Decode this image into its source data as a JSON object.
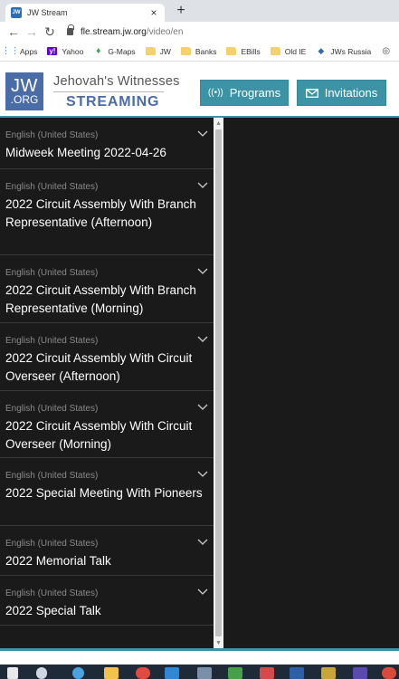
{
  "browser": {
    "tab_title": "JW Stream",
    "favicon_text": "JW",
    "tab_close": "×",
    "new_tab": "+",
    "url_host": "fle.stream.jw.org",
    "url_path": "/video/en",
    "bookmarks": [
      {
        "label": "Apps",
        "icon": "apps-grid-icon"
      },
      {
        "label": "Yahoo",
        "icon": "yahoo-icon"
      },
      {
        "label": "G-Maps",
        "icon": "map-pin-icon"
      },
      {
        "label": "JW",
        "icon": "folder-icon"
      },
      {
        "label": "Banks",
        "icon": "folder-icon"
      },
      {
        "label": "EBills",
        "icon": "folder-icon"
      },
      {
        "label": "Old IE",
        "icon": "folder-icon"
      },
      {
        "label": "JWs Russia",
        "icon": "jw-dove-icon"
      }
    ]
  },
  "header": {
    "logo_top": "JW",
    "logo_bottom": ".ORG",
    "brand_name": "Jehovah's Witnesses",
    "brand_sub": "STREAMING",
    "programs_label": "Programs",
    "invitations_label": "Invitations"
  },
  "programs": [
    {
      "language": "English (United States)",
      "title": "Midweek Meeting 2022-04-26"
    },
    {
      "language": "English (United States)",
      "title": "2022 Circuit Assembly With Branch Representative (Afternoon)"
    },
    {
      "language": "English (United States)",
      "title": "2022 Circuit Assembly With Branch Representative (Morning)"
    },
    {
      "language": "English (United States)",
      "title": "2022 Circuit Assembly With Circuit Overseer (Afternoon)"
    },
    {
      "language": "English (United States)",
      "title": "2022 Circuit Assembly With Circuit Overseer (Morning)"
    },
    {
      "language": "English (United States)",
      "title": "2022 Special Meeting With Pioneers"
    },
    {
      "language": "English (United States)",
      "title": "2022 Memorial Talk"
    },
    {
      "language": "English (United States)",
      "title": "2022 Special Talk"
    }
  ],
  "colors": {
    "accent": "#3d93a6",
    "logo": "#4a6da7",
    "list_background": "#1a1a1a"
  }
}
